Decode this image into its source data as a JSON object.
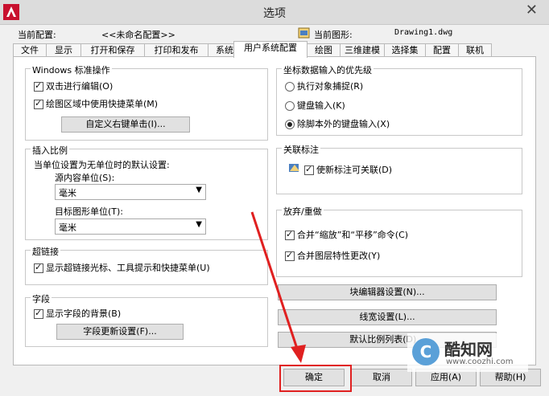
{
  "window": {
    "title": "选项",
    "close_glyph": "✕"
  },
  "header": {
    "current_profile_label": "当前配置:",
    "current_profile_value": "<<未命名配置>>",
    "current_drawing_label": "当前图形:",
    "current_drawing_value": "Drawing1.dwg"
  },
  "tabs": [
    "文件",
    "显示",
    "打开和保存",
    "打印和发布",
    "系统",
    "用户系统配置",
    "绘图",
    "三维建模",
    "选择集",
    "配置",
    "联机"
  ],
  "active_tab": "用户系统配置",
  "windows_group": {
    "title": "Windows 标准操作",
    "double_click_edit": "双击进行编辑(O)",
    "shortcut_menu": "绘图区域中使用快捷菜单(M)",
    "custom_right_click_button": "自定义右键单击(I)..."
  },
  "insert_scale": {
    "title": "插入比例",
    "desc": "当单位设置为无单位时的默认设置:",
    "source_label": "源内容单位(S):",
    "source_value": "毫米",
    "target_label": "目标图形单位(T):",
    "target_value": "毫米"
  },
  "hyperlink": {
    "title": "超链接",
    "show_cursor": "显示超链接光标、工具提示和快捷菜单(U)"
  },
  "fields": {
    "title": "字段",
    "show_background": "显示字段的背景(B)",
    "update_settings_button": "字段更新设置(F)..."
  },
  "coord_priority": {
    "title": "坐标数据输入的优先级",
    "options": [
      "执行对象捕捉(R)",
      "键盘输入(K)",
      "除脚本外的键盘输入(X)"
    ],
    "selected_index": 2
  },
  "assoc_dim": {
    "title": "关联标注",
    "make_associative": "使新标注可关联(D)"
  },
  "undo_redo": {
    "title": "放弃/重做",
    "combine_zoom_pan": "合并“缩放”和“平移”命令(C)",
    "combine_layer": "合并图层特性更改(Y)"
  },
  "side_buttons": {
    "block_editor": "块编辑器设置(N)...",
    "lineweight": "线宽设置(L)...",
    "default_scale_list": "默认比例列表(D)..."
  },
  "footer": {
    "ok": "确定",
    "cancel": "取消",
    "apply": "应用(A)",
    "help": "帮助(H)"
  },
  "watermark": {
    "logo_glyph": "C",
    "name": "酷知网",
    "url": "www.coozhi.com"
  },
  "colors": {
    "annotation_red": "#e02020",
    "watermark_blue": "#5aa0d8"
  }
}
